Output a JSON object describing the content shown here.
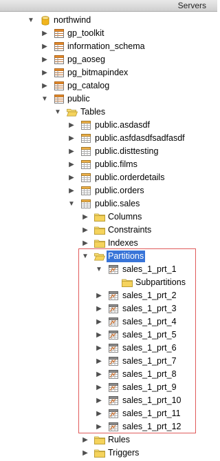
{
  "panel": {
    "title": "Servers"
  },
  "tree": [
    {
      "label": "northwind",
      "icon": "database-icon",
      "expander": "expanded",
      "depth": 0
    },
    {
      "label": "gp_toolkit",
      "icon": "schema-icon",
      "expander": "collapsed",
      "depth": 1
    },
    {
      "label": "information_schema",
      "icon": "schema-icon",
      "expander": "collapsed",
      "depth": 1
    },
    {
      "label": "pg_aoseg",
      "icon": "schema-icon",
      "expander": "collapsed",
      "depth": 1
    },
    {
      "label": "pg_bitmapindex",
      "icon": "schema-icon",
      "expander": "collapsed",
      "depth": 1
    },
    {
      "label": "pg_catalog",
      "icon": "schema-icon",
      "expander": "collapsed",
      "depth": 1
    },
    {
      "label": "public",
      "icon": "schema-icon",
      "expander": "expanded",
      "depth": 1
    },
    {
      "label": "Tables",
      "icon": "open-folder-icon",
      "expander": "expanded",
      "depth": 2
    },
    {
      "label": "public.asdasdf",
      "icon": "table-icon",
      "expander": "collapsed",
      "depth": 3
    },
    {
      "label": "public.asfdasdfsadfasdf",
      "icon": "table-icon",
      "expander": "collapsed",
      "depth": 3
    },
    {
      "label": "public.disttesting",
      "icon": "table-icon",
      "expander": "collapsed",
      "depth": 3
    },
    {
      "label": "public.films",
      "icon": "table-icon",
      "expander": "collapsed",
      "depth": 3
    },
    {
      "label": "public.orderdetails",
      "icon": "table-icon",
      "expander": "collapsed",
      "depth": 3
    },
    {
      "label": "public.orders",
      "icon": "table-icon",
      "expander": "collapsed",
      "depth": 3
    },
    {
      "label": "public.sales",
      "icon": "table-icon",
      "expander": "expanded",
      "depth": 3
    },
    {
      "label": "Columns",
      "icon": "folder-icon",
      "expander": "collapsed",
      "depth": 4
    },
    {
      "label": "Constraints",
      "icon": "folder-icon",
      "expander": "collapsed",
      "depth": 4
    },
    {
      "label": "Indexes",
      "icon": "folder-icon",
      "expander": "collapsed",
      "depth": 4
    },
    {
      "label": "Partitions",
      "icon": "open-folder-icon",
      "expander": "expanded",
      "depth": 4,
      "selected": true
    },
    {
      "label": "sales_1_prt_1",
      "icon": "partition-icon",
      "expander": "expanded",
      "depth": 5
    },
    {
      "label": "Subpartitions",
      "icon": "folder-icon",
      "expander": "none",
      "depth": 6
    },
    {
      "label": "sales_1_prt_2",
      "icon": "partition-icon",
      "expander": "collapsed",
      "depth": 5
    },
    {
      "label": "sales_1_prt_3",
      "icon": "partition-icon",
      "expander": "collapsed",
      "depth": 5
    },
    {
      "label": "sales_1_prt_4",
      "icon": "partition-icon",
      "expander": "collapsed",
      "depth": 5
    },
    {
      "label": "sales_1_prt_5",
      "icon": "partition-icon",
      "expander": "collapsed",
      "depth": 5
    },
    {
      "label": "sales_1_prt_6",
      "icon": "partition-icon",
      "expander": "collapsed",
      "depth": 5
    },
    {
      "label": "sales_1_prt_7",
      "icon": "partition-icon",
      "expander": "collapsed",
      "depth": 5
    },
    {
      "label": "sales_1_prt_8",
      "icon": "partition-icon",
      "expander": "collapsed",
      "depth": 5
    },
    {
      "label": "sales_1_prt_9",
      "icon": "partition-icon",
      "expander": "collapsed",
      "depth": 5
    },
    {
      "label": "sales_1_prt_10",
      "icon": "partition-icon",
      "expander": "collapsed",
      "depth": 5
    },
    {
      "label": "sales_1_prt_11",
      "icon": "partition-icon",
      "expander": "collapsed",
      "depth": 5
    },
    {
      "label": "sales_1_prt_12",
      "icon": "partition-icon",
      "expander": "collapsed",
      "depth": 5
    },
    {
      "label": "Rules",
      "icon": "folder-icon",
      "expander": "collapsed",
      "depth": 4
    },
    {
      "label": "Triggers",
      "icon": "folder-icon",
      "expander": "collapsed",
      "depth": 4
    }
  ],
  "colors": {
    "selection": "#3874d8",
    "highlight_box": "#e05a5a",
    "folder": "#f4d35e",
    "database": "#f2b51e"
  }
}
